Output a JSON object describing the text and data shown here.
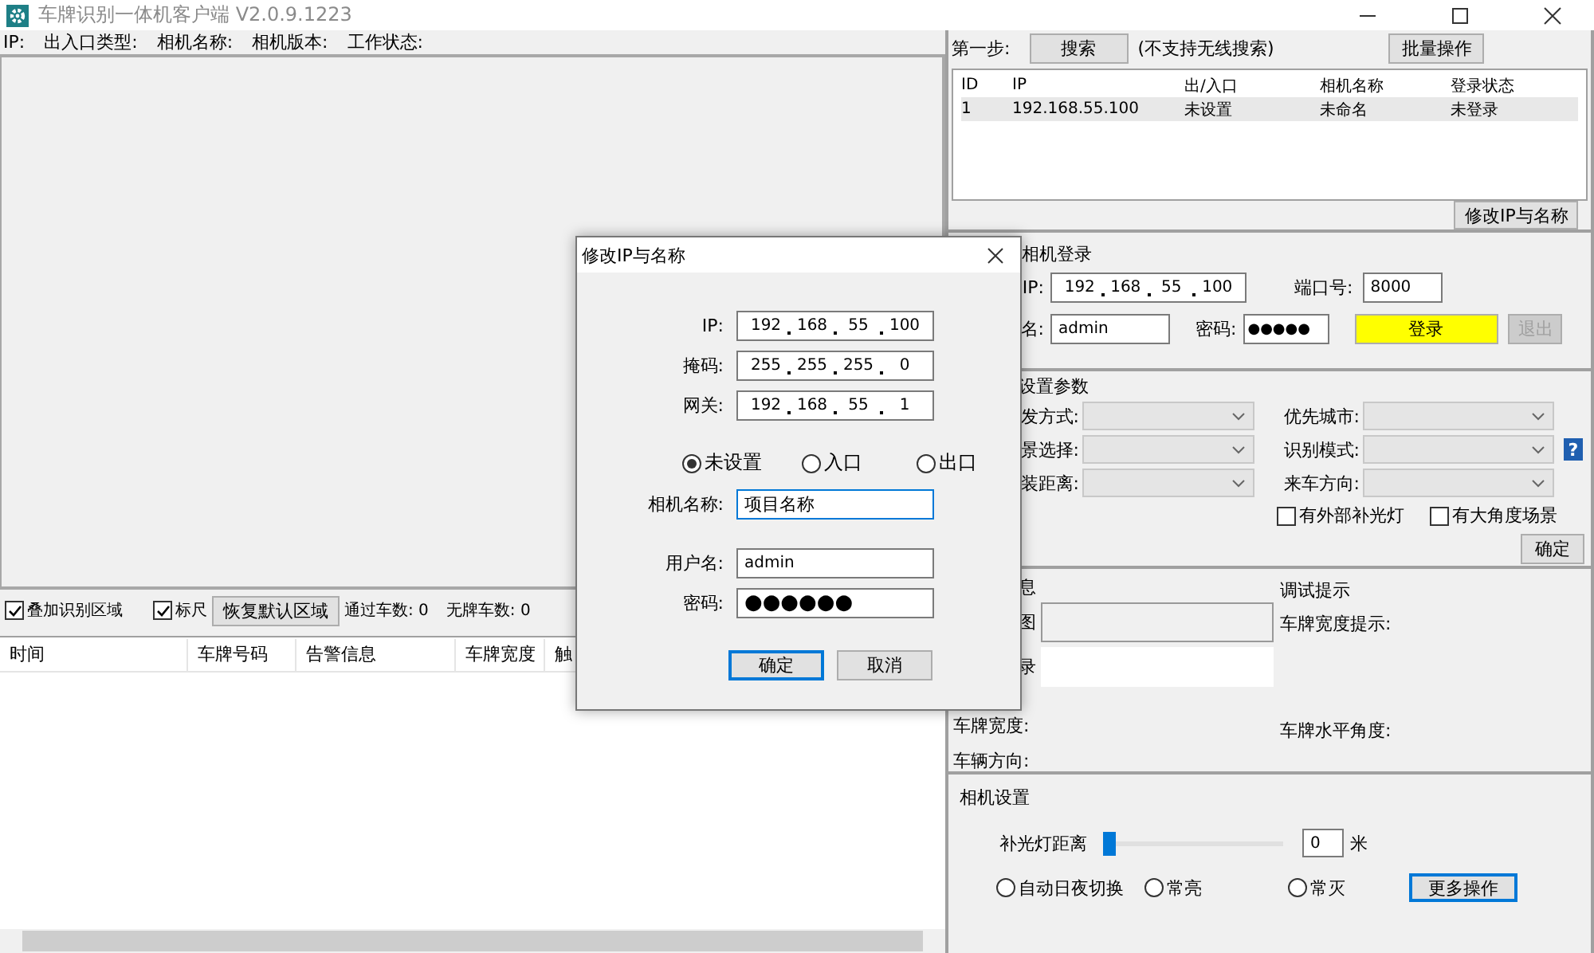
{
  "window": {
    "title": "车牌识别一体机客户端 V2.0.9.1223"
  },
  "info_bar": [
    "IP:",
    "出入口类型:",
    "相机名称:",
    "相机版本:",
    "工作状态:"
  ],
  "video_toolbar": {
    "checkboxes": [
      {
        "label": "叠加识别区域",
        "checked": true
      },
      {
        "label": "标尺",
        "checked": true
      }
    ],
    "button": "恢复默认区域",
    "counters": [
      "通过车数: 0",
      "无牌车数: 0"
    ]
  },
  "record_table": {
    "columns": [
      "时间",
      "车牌号码",
      "告警信息",
      "车牌宽度",
      "触"
    ]
  },
  "search_panel": {
    "step_label": "第一步:",
    "search_button": "搜索",
    "note": "(不支持无线搜索)",
    "batch_button": "批量操作",
    "columns": [
      "ID",
      "IP",
      "出/入口",
      "相机名称",
      "登录状态"
    ],
    "rows": [
      {
        "cells": [
          "1",
          "192.168.55.100",
          "未设置",
          "未命名",
          "未登录"
        ],
        "selected": true
      }
    ],
    "edit_button": "修改IP与名称"
  },
  "login_panel": {
    "title": "相机登录",
    "ip_label": "IP:",
    "ip": [
      "192",
      "168",
      "55",
      "100"
    ],
    "port_label": "端口号:",
    "port": "8000",
    "user_label": "名:",
    "user": "admin",
    "password_label": "密码:",
    "password": "●●●●●",
    "login_button": "登录",
    "logout_button": {
      "label": "退出",
      "disabled": true
    }
  },
  "settings_panel": {
    "title": "设置参数",
    "left_fields": [
      "发方式:",
      "景选择:",
      "装距离:"
    ],
    "right_fields": [
      "优先城市:",
      "识别模式:",
      "来车方向:"
    ],
    "help": "?",
    "checkboxes": [
      {
        "label": "有外部补光灯",
        "checked": false
      },
      {
        "label": "有大角度场景",
        "checked": false
      }
    ],
    "ok_button": "确定"
  },
  "result_panel": {
    "title": "息",
    "image_label": "图",
    "result_label": "录",
    "left_labels": [
      "车牌宽度:",
      "车辆方向:"
    ],
    "hint_title": "调试提示",
    "hints": [
      "车牌宽度提示:",
      "车牌水平角度:"
    ]
  },
  "camera_panel": {
    "title": "相机设置",
    "slider": {
      "label": "补光灯距离",
      "level": 0
    },
    "distance": "0",
    "unit": "米",
    "modes": [
      {
        "label": "自动日夜切换",
        "selected": false
      },
      {
        "label": "常亮",
        "selected": false
      },
      {
        "label": "常灭",
        "selected": false
      }
    ],
    "more_button": "更多操作"
  },
  "dialog": {
    "title": "修改IP与名称",
    "ip_fields": [
      {
        "label": "IP:",
        "octets": [
          "192",
          "168",
          "55",
          "100"
        ]
      },
      {
        "label": "掩码:",
        "octets": [
          "255",
          "255",
          "255",
          "0"
        ]
      },
      {
        "label": "网关:",
        "octets": [
          "192",
          "168",
          "55",
          "1"
        ]
      }
    ],
    "directions": [
      {
        "label": "未设置",
        "selected": true
      },
      {
        "label": "入口",
        "selected": false
      },
      {
        "label": "出口",
        "selected": false
      }
    ],
    "name_label": "相机名称:",
    "name": "项目名称",
    "user_label": "用户名:",
    "user": "admin",
    "password_label": "密码:",
    "password": "●●●●●●",
    "ok_button": "确定",
    "cancel_button": "取消"
  }
}
